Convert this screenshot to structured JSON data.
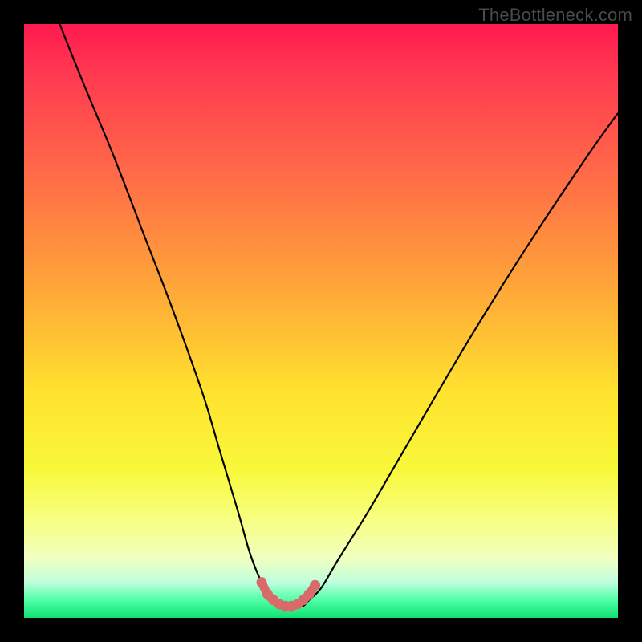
{
  "watermark": "TheBottleneck.com",
  "chart_data": {
    "type": "line",
    "title": "",
    "xlabel": "",
    "ylabel": "",
    "xlim": [
      0,
      100
    ],
    "ylim": [
      0,
      100
    ],
    "series": [
      {
        "name": "bottleneck-curve",
        "x": [
          6,
          10,
          15,
          20,
          25,
          30,
          33,
          36,
          38,
          40,
          42,
          44,
          46,
          47,
          48,
          50,
          53,
          58,
          65,
          75,
          85,
          95,
          100
        ],
        "values": [
          100,
          90,
          78,
          65,
          52,
          38,
          28,
          18,
          11,
          6,
          3,
          2,
          2,
          2,
          3,
          5,
          10,
          18,
          30,
          47,
          63,
          78,
          85
        ]
      }
    ],
    "highlight": {
      "name": "valley-marker",
      "color": "#d96a6a",
      "x": [
        40,
        41,
        42,
        43,
        44,
        45,
        46,
        47,
        48,
        49
      ],
      "values": [
        6,
        4,
        3,
        2.3,
        2,
        2,
        2.3,
        3,
        4,
        5.5
      ]
    },
    "background_gradient": {
      "type": "vertical",
      "stops": [
        {
          "pos": 0,
          "color": "#ff1a50"
        },
        {
          "pos": 45,
          "color": "#ffa838"
        },
        {
          "pos": 75,
          "color": "#f8f83a"
        },
        {
          "pos": 100,
          "color": "#10e072"
        }
      ]
    }
  }
}
